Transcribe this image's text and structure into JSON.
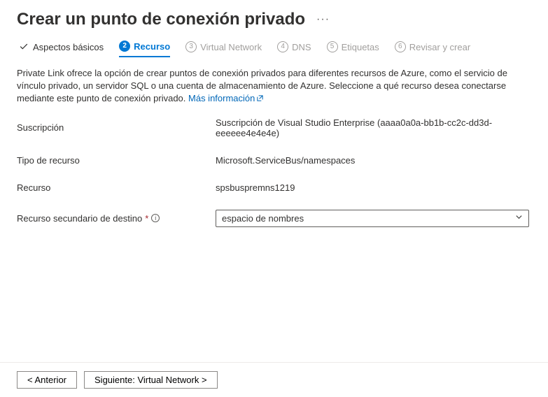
{
  "header": {
    "title": "Crear un punto de conexión privado"
  },
  "tabs": {
    "basics": "Aspectos básicos",
    "resource": "Recurso",
    "vnet_num": "3",
    "vnet": "Virtual Network",
    "dns_num": "4",
    "dns": "DNS",
    "tags_num": "5",
    "tags": "Etiquetas",
    "review_num": "6",
    "review": "Revisar y crear",
    "active_num": "2"
  },
  "intro": {
    "text": "Private Link ofrece la opción de crear puntos de conexión privados para diferentes recursos de Azure, como el servicio de vínculo privado, un servidor SQL o una cuenta de almacenamiento de Azure. Seleccione a qué recurso desea conectarse mediante este punto de conexión privado. ",
    "link": "Más información"
  },
  "fields": {
    "subscription_label": "Suscripción",
    "subscription_value": "Suscripción de Visual Studio Enterprise (aaaa0a0a-bb1b-cc2c-dd3d-eeeeee4e4e4e)",
    "resource_type_label": "Tipo de recurso",
    "resource_type_value": "Microsoft.ServiceBus/namespaces",
    "resource_label": "Recurso",
    "resource_value": "spsbuspremns1219",
    "subresource_label": "Recurso secundario de destino",
    "subresource_value": "espacio de nombres"
  },
  "footer": {
    "prev": "< Anterior",
    "next": "Siguiente: Virtual Network >"
  }
}
